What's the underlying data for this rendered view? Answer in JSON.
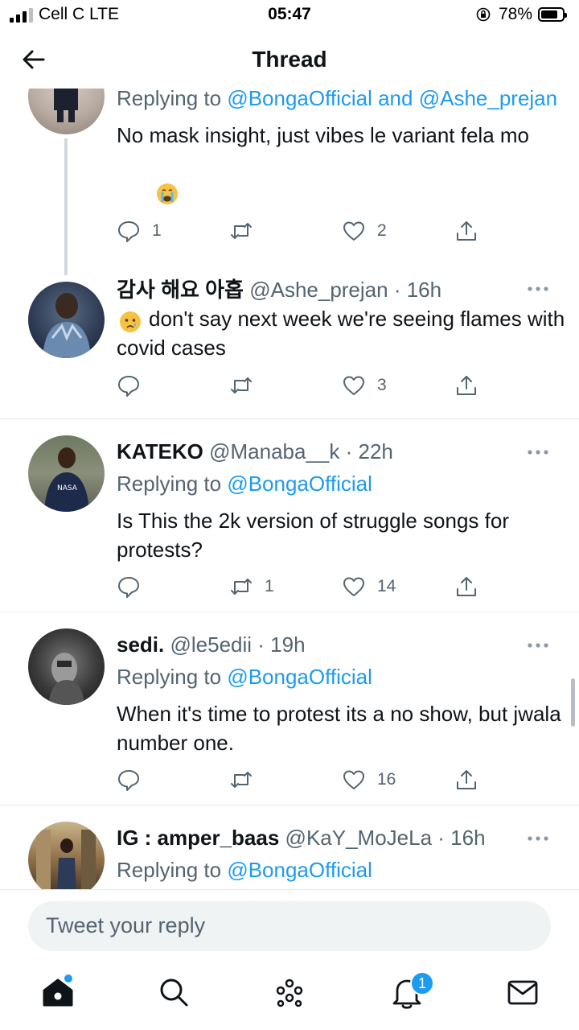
{
  "status_bar": {
    "carrier": "Cell C  LTE",
    "time": "05:47",
    "battery": "78%",
    "battery_level": 0.78
  },
  "header": {
    "title": "Thread"
  },
  "tweets": [
    {
      "reply_label": "Replying to ",
      "mentions": "@BongaOfficial and @Ashe_prejan",
      "text": "No mask insight, just vibes le variant fela mo",
      "reply_count": "1",
      "retweet_count": "",
      "like_count": "2"
    },
    {
      "name": "감사 해요 아홉",
      "handle": "@Ashe_prejan",
      "time": "16h",
      "text": "don't say next week we're seeing flames with covid cases",
      "reply_count": "",
      "retweet_count": "",
      "like_count": "3"
    },
    {
      "name": "KATEKO",
      "handle": "@Manaba__k",
      "time": "22h",
      "reply_label": "Replying to ",
      "mentions": "@BongaOfficial",
      "text": "Is This the 2k version of struggle songs for protests?",
      "reply_count": "",
      "retweet_count": "1",
      "like_count": "14"
    },
    {
      "name": "sedi.",
      "handle": "@le5edii",
      "time": "19h",
      "reply_label": "Replying to ",
      "mentions": "@BongaOfficial",
      "text": "When it's time to protest its a no show, but jwala number one.",
      "reply_count": "",
      "retweet_count": "",
      "like_count": "16"
    },
    {
      "name": "IG : amper_baas",
      "handle": "@KaY_MoJeLa",
      "time": "16h",
      "reply_label": "Replying to ",
      "mentions": "@BongaOfficial"
    }
  ],
  "reply_box": {
    "placeholder": "Tweet your reply"
  },
  "bottom_nav": {
    "notification_count": "1"
  },
  "colors": {
    "accent": "#1d9bf0",
    "text_primary": "#0f1419",
    "text_secondary": "#536471",
    "divider": "#e6e9eb"
  },
  "icons": [
    "back-arrow-icon",
    "more-icon",
    "reply-icon",
    "retweet-icon",
    "like-icon",
    "share-icon",
    "home-icon",
    "search-icon",
    "spaces-icon",
    "notifications-icon",
    "messages-icon"
  ]
}
